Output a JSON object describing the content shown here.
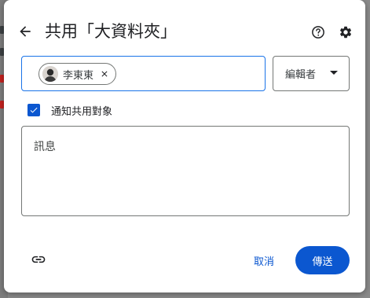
{
  "dialog": {
    "title": "共用「大資料夾」",
    "icons": {
      "back": "arrow-back-icon",
      "help": "help-circle-icon",
      "settings": "gear-icon"
    }
  },
  "people_field": {
    "chips": [
      {
        "name": "李東東",
        "avatar": "user-avatar"
      }
    ]
  },
  "role_select": {
    "selected": "編輯者"
  },
  "notify": {
    "label": "通知共用對象",
    "checked": true
  },
  "message": {
    "placeholder": "訊息"
  },
  "footer": {
    "copy_link_icon": "link-icon",
    "cancel_label": "取消",
    "send_label": "傳送"
  },
  "colors": {
    "accent": "#0b57d0",
    "focus_border": "#1a73e8",
    "text": "#202124"
  }
}
